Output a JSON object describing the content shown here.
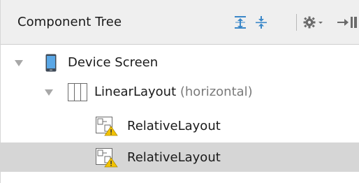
{
  "panel": {
    "title": "Component Tree"
  },
  "toolbar": {
    "icons": [
      "expand-all-icon",
      "collapse-all-icon",
      "gear-icon",
      "hide-panel-icon"
    ]
  },
  "tree": {
    "nodes": [
      {
        "label": "Device Screen",
        "hint": "",
        "icon": "phone-icon",
        "expanded": true,
        "selected": false,
        "warning": false
      },
      {
        "label": "LinearLayout",
        "hint": "(horizontal)",
        "icon": "linear-layout-icon",
        "expanded": true,
        "selected": false,
        "warning": false
      },
      {
        "label": "RelativeLayout",
        "hint": "",
        "icon": "relative-layout-icon",
        "expanded": false,
        "selected": false,
        "warning": true
      },
      {
        "label": "RelativeLayout",
        "hint": "",
        "icon": "relative-layout-icon",
        "expanded": false,
        "selected": true,
        "warning": true
      }
    ]
  },
  "colors": {
    "header_bg": "#efefef",
    "selection_bg": "#d6d6d6",
    "warning": "#f2c200"
  }
}
